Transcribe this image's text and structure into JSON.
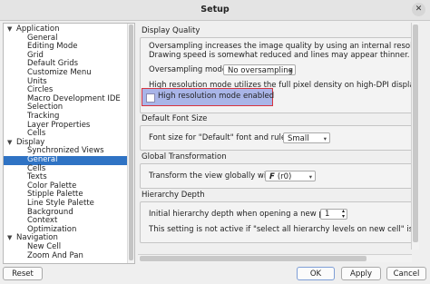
{
  "window": {
    "title": "Setup",
    "close_glyph": "✕"
  },
  "tree": {
    "items": [
      {
        "label": "Application",
        "level": 0,
        "expanded": true
      },
      {
        "label": "General",
        "level": 1
      },
      {
        "label": "Editing Mode",
        "level": 1
      },
      {
        "label": "Grid",
        "level": 1
      },
      {
        "label": "Default Grids",
        "level": 1
      },
      {
        "label": "Customize Menu",
        "level": 1
      },
      {
        "label": "Units",
        "level": 1
      },
      {
        "label": "Circles",
        "level": 1
      },
      {
        "label": "Macro Development IDE",
        "level": 1
      },
      {
        "label": "Selection",
        "level": 1
      },
      {
        "label": "Tracking",
        "level": 1
      },
      {
        "label": "Layer Properties",
        "level": 1
      },
      {
        "label": "Cells",
        "level": 1
      },
      {
        "label": "Display",
        "level": 0,
        "expanded": true
      },
      {
        "label": "Synchronized Views",
        "level": 1
      },
      {
        "label": "General",
        "level": 1,
        "selected": true
      },
      {
        "label": "Cells",
        "level": 1
      },
      {
        "label": "Texts",
        "level": 1
      },
      {
        "label": "Color Palette",
        "level": 1
      },
      {
        "label": "Stipple Palette",
        "level": 1
      },
      {
        "label": "Line Style Palette",
        "level": 1
      },
      {
        "label": "Background",
        "level": 1
      },
      {
        "label": "Context",
        "level": 1
      },
      {
        "label": "Optimization",
        "level": 1
      },
      {
        "label": "Navigation",
        "level": 0,
        "expanded": true
      },
      {
        "label": "New Cell",
        "level": 1
      },
      {
        "label": "Zoom And Pan",
        "level": 1
      }
    ]
  },
  "display_quality": {
    "title": "Display Quality",
    "desc_line1": "Oversampling increases the image quality by using an internal resolution larger th",
    "desc_line2": "Drawing speed is somewhat reduced and lines may appear thinner.",
    "oversampling_label": "Oversampling mode",
    "oversampling_value": "No oversampling",
    "hires_desc": "High resolution mode utilizes the full pixel density on high-DPI displays. Feature",
    "hires_checkbox_label": "High resolution mode enabled",
    "hires_checked": false
  },
  "default_font": {
    "title": "Default Font Size",
    "label": "Font size for \"Default\" font and rulers",
    "value": "Small"
  },
  "global_transform": {
    "title": "Global Transformation",
    "label": "Transform the view globally with",
    "value": "(r0)"
  },
  "hierarchy": {
    "title": "Hierarchy Depth",
    "label": "Initial hierarchy depth when opening a new panel",
    "value": "1",
    "note": "This setting is not active if \"select all hierarchy levels on new cell\" is checked on"
  },
  "buttons": {
    "reset": "Reset",
    "ok": "OK",
    "apply": "Apply",
    "cancel": "Cancel"
  },
  "icons": {
    "expand": "chevron-down-icon",
    "combo": "chevron-down-icon",
    "transform": "rotation-f-icon"
  }
}
